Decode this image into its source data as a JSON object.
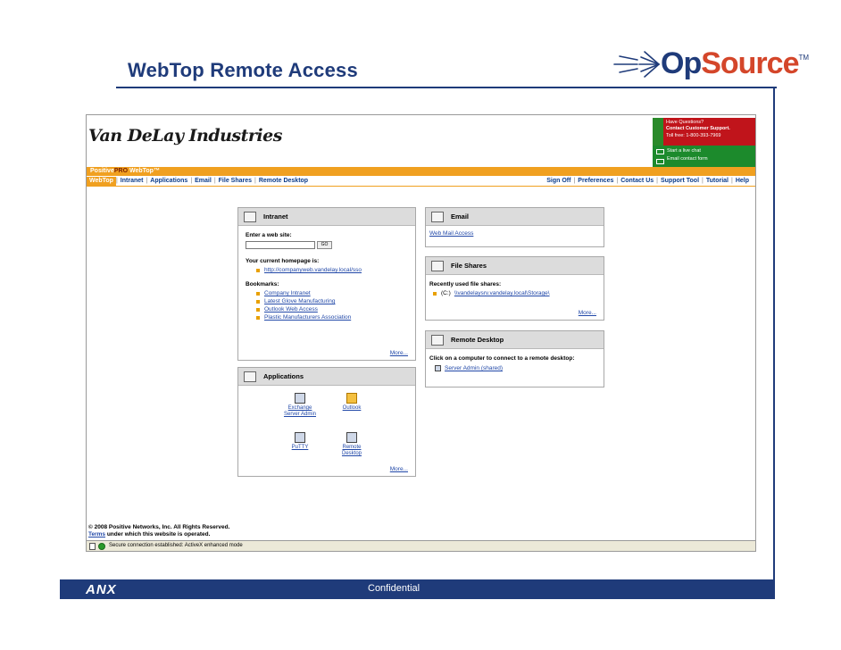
{
  "slide": {
    "title": "WebTop Remote Access",
    "footer_confidential": "Confidential",
    "footer_logo": "ANX"
  },
  "logo": {
    "part1": "Op",
    "part2": "Source",
    "tm": "TM"
  },
  "browser": {
    "company_name": "Van DeLay Industries",
    "support": {
      "line1": "Have Questions?",
      "line2": "Contact Customer Support.",
      "line3": "Toll free: 1-800-393-7969",
      "chat": "Start a live chat",
      "email_form": "Email contact form"
    },
    "product_bar": {
      "positive": "Positive",
      "pro": "PRO",
      "webtop": "WebTop™"
    },
    "nav_left": [
      "WebTop",
      "Intranet",
      "Applications",
      "Email",
      "File Shares",
      "Remote Desktop"
    ],
    "nav_right": [
      "Sign Off",
      "Preferences",
      "Contact Us",
      "Support Tool",
      "Tutorial",
      "Help"
    ],
    "intranet": {
      "title": "Intranet",
      "enter_label": "Enter a web site:",
      "go_label": "GO",
      "homepage_label": "Your current homepage is:",
      "homepage_url": "http://companyweb.vandelay.local/sso",
      "bookmarks_label": "Bookmarks:",
      "bookmarks": [
        "Company Intranet",
        "Latest Glove Manufacturing",
        "Outlook Web Access",
        "Plastic Manufacturers Association"
      ],
      "more": "More..."
    },
    "applications": {
      "title": "Applications",
      "apps": [
        {
          "label": "Exchange Server Admin"
        },
        {
          "label": "Outlook"
        },
        {
          "label": "PuTTY"
        },
        {
          "label": "Remote Desktop"
        }
      ],
      "more": "More..."
    },
    "email": {
      "title": "Email",
      "link": "Web Mail Access"
    },
    "file_shares": {
      "title": "File Shares",
      "recent_label": "Recently used file shares:",
      "item_drive": "(C:)",
      "item_path": "\\\\vandelaysrv.vandelay.local\\Storage\\",
      "more": "More..."
    },
    "remote_desktop": {
      "title": "Remote Desktop",
      "instructions": "Click on a computer to connect to a remote desktop:",
      "computer": "Server Admin (shared)"
    },
    "footer": {
      "copyright": "© 2008 Positive Networks, Inc. All Rights Reserved.",
      "terms_link": "Terms",
      "terms_rest": " under which this website is operated."
    },
    "status_text": "Secure connection established: ActiveX enhanced mode"
  }
}
